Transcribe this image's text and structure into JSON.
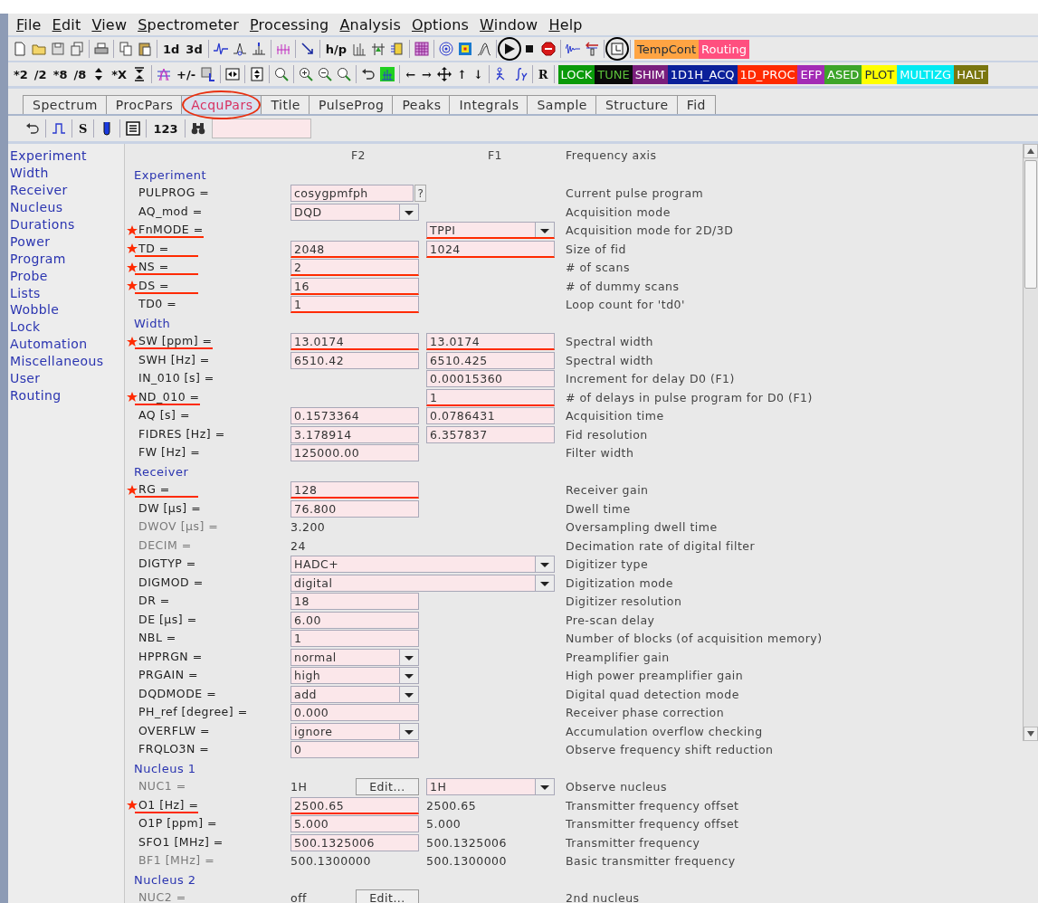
{
  "menu": [
    "File",
    "Edit",
    "View",
    "Spectrometer",
    "Processing",
    "Analysis",
    "Options",
    "Window",
    "Help"
  ],
  "toolbar_1": {
    "items": [
      {
        "kind": "icon",
        "circled": false
      },
      {
        "kind": "icon",
        "circled": false
      },
      {
        "kind": "icon",
        "circled": false
      },
      {
        "kind": "icon",
        "circled": false
      },
      {
        "kind": "separator"
      },
      {
        "kind": "icon",
        "circled": false
      },
      {
        "kind": "separator"
      },
      {
        "kind": "icon",
        "circled": false
      },
      {
        "kind": "icon",
        "circled": false
      },
      {
        "kind": "separator"
      },
      {
        "kind": "text",
        "label": "1d"
      },
      {
        "kind": "text",
        "label": "3d"
      },
      {
        "kind": "separator"
      },
      {
        "kind": "icon",
        "circled": false
      },
      {
        "kind": "icon",
        "circled": false
      },
      {
        "kind": "icon",
        "circled": false
      },
      {
        "kind": "separator"
      },
      {
        "kind": "icon",
        "circled": false
      },
      {
        "kind": "separator"
      },
      {
        "kind": "icon",
        "circled": false
      },
      {
        "kind": "separator"
      },
      {
        "kind": "text",
        "label": "h/p"
      },
      {
        "kind": "icon",
        "circled": false
      },
      {
        "kind": "icon",
        "circled": false
      },
      {
        "kind": "icon",
        "circled": false
      },
      {
        "kind": "separator"
      },
      {
        "kind": "icon",
        "circled": false
      },
      {
        "kind": "separator"
      },
      {
        "kind": "icon",
        "circled": false
      },
      {
        "kind": "icon",
        "circled": false
      },
      {
        "kind": "icon",
        "circled": false
      },
      {
        "kind": "separator"
      },
      {
        "kind": "icon",
        "circled": true
      },
      {
        "kind": "icon",
        "circled": false
      },
      {
        "kind": "icon",
        "circled": false
      },
      {
        "kind": "separator"
      },
      {
        "kind": "icon",
        "circled": false
      },
      {
        "kind": "icon",
        "circled": false
      },
      {
        "kind": "separator"
      },
      {
        "kind": "icon",
        "circled": true
      },
      {
        "kind": "separator"
      },
      {
        "kind": "color",
        "label": "TempCont",
        "color": "#ffa443"
      },
      {
        "kind": "color",
        "label": "Routing",
        "color": "#ff4f7f"
      }
    ]
  },
  "toolbar_2": {
    "items": [
      {
        "kind": "text",
        "label": "*2"
      },
      {
        "kind": "text",
        "label": "/2"
      },
      {
        "kind": "text",
        "label": "*8"
      },
      {
        "kind": "text",
        "label": "/8"
      },
      {
        "kind": "icon",
        "circled": false
      },
      {
        "kind": "text",
        "label": "*X"
      },
      {
        "kind": "icon",
        "circled": false
      },
      {
        "kind": "separator"
      },
      {
        "kind": "icon",
        "circled": false
      },
      {
        "kind": "text",
        "label": "+/-"
      },
      {
        "kind": "icon",
        "circled": false
      },
      {
        "kind": "separator"
      },
      {
        "kind": "icon",
        "circled": false
      },
      {
        "kind": "separator"
      },
      {
        "kind": "icon",
        "circled": false
      },
      {
        "kind": "separator"
      },
      {
        "kind": "icon",
        "circled": false
      },
      {
        "kind": "separator"
      },
      {
        "kind": "icon",
        "circled": false
      },
      {
        "kind": "icon",
        "circled": false
      },
      {
        "kind": "icon",
        "circled": false
      },
      {
        "kind": "separator"
      },
      {
        "kind": "icon",
        "circled": false
      },
      {
        "kind": "icon",
        "circled": false
      },
      {
        "kind": "separator"
      },
      {
        "kind": "text",
        "label": "←"
      },
      {
        "kind": "text",
        "label": "→"
      },
      {
        "kind": "icon",
        "circled": false
      },
      {
        "kind": "text",
        "label": "↑"
      },
      {
        "kind": "text",
        "label": "↓"
      },
      {
        "kind": "separator"
      },
      {
        "kind": "icon",
        "circled": false
      },
      {
        "kind": "icon",
        "circled": false
      },
      {
        "kind": "separator"
      },
      {
        "kind": "text",
        "label": "R"
      },
      {
        "kind": "separator"
      },
      {
        "kind": "color",
        "label": "LOCK",
        "color": "#0a9a0a"
      },
      {
        "kind": "color",
        "label": "TUNE",
        "color": "#0a0a0a"
      },
      {
        "kind": "color",
        "label": "SHIM",
        "color": "#7a1f7d"
      },
      {
        "kind": "color",
        "label": "1D1H_ACQ",
        "color": "#0b209a"
      },
      {
        "kind": "color",
        "label": "1D_PROC",
        "color": "#ff2a00"
      },
      {
        "kind": "color",
        "label": "EFP",
        "color": "#a32bb5"
      },
      {
        "kind": "color",
        "label": "ASED",
        "color": "#3da52a"
      },
      {
        "kind": "color",
        "label": "PLOT",
        "color": "#ffff00"
      },
      {
        "kind": "color",
        "label": "MULTIZG",
        "color": "#00eaf2"
      },
      {
        "kind": "color",
        "label": "HALT",
        "color": "#7a7610"
      }
    ]
  },
  "tabs": [
    {
      "label": "Spectrum",
      "selected": false,
      "circled": false
    },
    {
      "label": "ProcPars",
      "selected": false,
      "circled": false
    },
    {
      "label": "AcquPars",
      "selected": true,
      "circled": true
    },
    {
      "label": "Title",
      "selected": false,
      "circled": false
    },
    {
      "label": "PulseProg",
      "selected": false,
      "circled": false
    },
    {
      "label": "Peaks",
      "selected": false,
      "circled": false
    },
    {
      "label": "Integrals",
      "selected": false,
      "circled": false
    },
    {
      "label": "Sample",
      "selected": false,
      "circled": false
    },
    {
      "label": "Structure",
      "selected": false,
      "circled": false
    },
    {
      "label": "Fid",
      "selected": false,
      "circled": false
    }
  ],
  "sub_toolbar": {
    "items": [
      {
        "kind": "icon"
      },
      {
        "kind": "separator"
      },
      {
        "kind": "icon"
      },
      {
        "kind": "separator"
      },
      {
        "kind": "text",
        "label": "S"
      },
      {
        "kind": "separator"
      },
      {
        "kind": "icon"
      },
      {
        "kind": "separator"
      },
      {
        "kind": "icon"
      },
      {
        "kind": "separator"
      },
      {
        "kind": "text",
        "label": "123"
      },
      {
        "kind": "separator"
      },
      {
        "kind": "icon"
      },
      {
        "kind": "field"
      }
    ]
  },
  "sidebar": {
    "items": [
      "Experiment",
      "Width",
      "Receiver",
      "Nucleus",
      "Durations",
      "Power",
      "Program",
      "Probe",
      "Lists",
      "Wobble",
      "Lock",
      "Automation",
      "Miscellaneous",
      "User",
      "Routing"
    ]
  },
  "table": {
    "columns": [
      "F2",
      "F1",
      "Frequency axis"
    ],
    "rows": [
      {
        "kind": "section",
        "label": "Experiment"
      },
      {
        "kind": "param",
        "label": "PULPROG =",
        "starred": false,
        "dim": false,
        "f2": {
          "kind": "program",
          "value": "cosygpmfph",
          "button": "?",
          "marked": false
        },
        "desc": "Current pulse program"
      },
      {
        "kind": "param",
        "label": "AQ_mod =",
        "starred": false,
        "dim": false,
        "f2": {
          "kind": "select",
          "value": "DQD",
          "marked": false
        },
        "desc": "Acquisition mode"
      },
      {
        "kind": "param",
        "label": "FnMODE =",
        "starred": true,
        "dim": false,
        "f1": {
          "kind": "select",
          "value": "TPPI",
          "marked": true
        },
        "desc": "Acquisition mode for 2D/3D"
      },
      {
        "kind": "param",
        "label": "TD =",
        "starred": true,
        "dim": false,
        "f2": {
          "kind": "input",
          "value": "2048",
          "marked": true
        },
        "f1": {
          "kind": "input",
          "value": "1024",
          "marked": true
        },
        "desc": "Size of fid"
      },
      {
        "kind": "param",
        "label": "NS =",
        "starred": true,
        "dim": false,
        "f2": {
          "kind": "input",
          "value": "2",
          "marked": true
        },
        "desc": "# of scans"
      },
      {
        "kind": "param",
        "label": "DS =",
        "starred": true,
        "dim": false,
        "f2": {
          "kind": "input",
          "value": "16",
          "marked": true
        },
        "desc": "# of dummy scans"
      },
      {
        "kind": "param",
        "label": "TD0 =",
        "starred": false,
        "dim": false,
        "f2": {
          "kind": "input",
          "value": "1",
          "marked": true
        },
        "desc": "Loop count for 'td0'"
      },
      {
        "kind": "section",
        "label": "Width"
      },
      {
        "kind": "param",
        "label": "SW [ppm] =",
        "starred": true,
        "dim": false,
        "f2": {
          "kind": "input",
          "value": "13.0174",
          "marked": true
        },
        "f1": {
          "kind": "input",
          "value": "13.0174",
          "marked": true
        },
        "desc": "Spectral width"
      },
      {
        "kind": "param",
        "label": "SWH [Hz] =",
        "starred": false,
        "dim": false,
        "f2": {
          "kind": "input",
          "value": "6510.42",
          "marked": false
        },
        "f1": {
          "kind": "input",
          "value": "6510.425",
          "marked": false
        },
        "desc": "Spectral width"
      },
      {
        "kind": "param",
        "label": "IN_010 [s] =",
        "starred": false,
        "dim": false,
        "f1": {
          "kind": "input",
          "value": "0.00015360",
          "marked": false
        },
        "desc": "Increment for delay D0 (F1)"
      },
      {
        "kind": "param",
        "label": "ND_010 =",
        "starred": true,
        "dim": false,
        "f1": {
          "kind": "input",
          "value": "1",
          "marked": true
        },
        "desc": "# of delays in pulse program for D0 (F1)"
      },
      {
        "kind": "param",
        "label": "AQ [s] =",
        "starred": false,
        "dim": false,
        "f2": {
          "kind": "input",
          "value": "0.1573364",
          "marked": false
        },
        "f1": {
          "kind": "input",
          "value": "0.0786431",
          "marked": false
        },
        "desc": "Acquisition time"
      },
      {
        "kind": "param",
        "label": "FIDRES [Hz] =",
        "starred": false,
        "dim": false,
        "f2": {
          "kind": "input",
          "value": "3.178914",
          "marked": false
        },
        "f1": {
          "kind": "input",
          "value": "6.357837",
          "marked": false
        },
        "desc": "Fid resolution"
      },
      {
        "kind": "param",
        "label": "FW [Hz] =",
        "starred": false,
        "dim": false,
        "f2": {
          "kind": "input",
          "value": "125000.00",
          "marked": false
        },
        "desc": "Filter width"
      },
      {
        "kind": "section",
        "label": "Receiver"
      },
      {
        "kind": "param",
        "label": "RG =",
        "starred": true,
        "dim": false,
        "f2": {
          "kind": "input",
          "value": "128",
          "marked": true
        },
        "desc": "Receiver gain"
      },
      {
        "kind": "param",
        "label": "DW [µs] =",
        "starred": false,
        "dim": false,
        "f2": {
          "kind": "input",
          "value": "76.800",
          "marked": false
        },
        "desc": "Dwell time"
      },
      {
        "kind": "param",
        "label": "DWOV [µs] =",
        "starred": false,
        "dim": true,
        "f2": {
          "kind": "plain",
          "value": "3.200",
          "marked": false
        },
        "desc": "Oversampling dwell time"
      },
      {
        "kind": "param",
        "label": "DECIM =",
        "starred": false,
        "dim": true,
        "f2": {
          "kind": "plain",
          "value": "24",
          "marked": false
        },
        "desc": "Decimation rate of digital filter"
      },
      {
        "kind": "param",
        "label": "DIGTYP =",
        "starred": false,
        "dim": false,
        "f2": {
          "kind": "select",
          "value": "HADC+",
          "wide": true,
          "marked": false
        },
        "desc": "Digitizer type"
      },
      {
        "kind": "param",
        "label": "DIGMOD =",
        "starred": false,
        "dim": false,
        "f2": {
          "kind": "select",
          "value": "digital",
          "wide": true,
          "marked": false
        },
        "desc": "Digitization mode"
      },
      {
        "kind": "param",
        "label": "DR =",
        "starred": false,
        "dim": false,
        "f2": {
          "kind": "input",
          "value": "18",
          "marked": false
        },
        "desc": "Digitizer resolution"
      },
      {
        "kind": "param",
        "label": "DE [µs] =",
        "starred": false,
        "dim": false,
        "f2": {
          "kind": "input",
          "value": "6.00",
          "marked": false
        },
        "desc": "Pre-scan delay"
      },
      {
        "kind": "param",
        "label": "NBL =",
        "starred": false,
        "dim": false,
        "f2": {
          "kind": "input",
          "value": "1",
          "marked": false
        },
        "desc": "Number of blocks (of acquisition memory)"
      },
      {
        "kind": "param",
        "label": "HPPRGN =",
        "starred": false,
        "dim": false,
        "f2": {
          "kind": "select",
          "value": "normal",
          "marked": false
        },
        "desc": "Preamplifier gain"
      },
      {
        "kind": "param",
        "label": "PRGAIN =",
        "starred": false,
        "dim": false,
        "f2": {
          "kind": "select",
          "value": "high",
          "marked": false
        },
        "desc": "High power preamplifier gain"
      },
      {
        "kind": "param",
        "label": "DQDMODE =",
        "starred": false,
        "dim": false,
        "f2": {
          "kind": "select",
          "value": "add",
          "marked": false
        },
        "desc": "Digital quad detection mode"
      },
      {
        "kind": "param",
        "label": "PH_ref [degree] =",
        "starred": false,
        "dim": false,
        "f2": {
          "kind": "input",
          "value": "0.000",
          "marked": false
        },
        "desc": "Receiver phase correction"
      },
      {
        "kind": "param",
        "label": "OVERFLW =",
        "starred": false,
        "dim": false,
        "f2": {
          "kind": "select",
          "value": "ignore",
          "marked": false
        },
        "desc": "Accumulation overflow checking"
      },
      {
        "kind": "param",
        "label": "FRQLO3N =",
        "starred": false,
        "dim": false,
        "f2": {
          "kind": "input",
          "value": "0",
          "marked": false
        },
        "desc": "Observe frequency shift reduction"
      },
      {
        "kind": "section",
        "label": "Nucleus 1"
      },
      {
        "kind": "param",
        "label": "NUC1 =",
        "starred": false,
        "dim": true,
        "f2": {
          "kind": "edit",
          "value": "1H",
          "button": "Edit...",
          "marked": false
        },
        "f1": {
          "kind": "select",
          "value": "1H",
          "marked": false
        },
        "desc": "Observe nucleus"
      },
      {
        "kind": "param",
        "label": "O1 [Hz] =",
        "starred": true,
        "dim": false,
        "f2": {
          "kind": "input",
          "value": "2500.65",
          "marked": true
        },
        "f1": {
          "kind": "plain",
          "value": "2500.65",
          "marked": false
        },
        "desc": "Transmitter frequency offset"
      },
      {
        "kind": "param",
        "label": "O1P [ppm] =",
        "starred": false,
        "dim": false,
        "f2": {
          "kind": "input",
          "value": "5.000",
          "marked": false
        },
        "f1": {
          "kind": "plain",
          "value": "5.000",
          "marked": false
        },
        "desc": "Transmitter frequency offset"
      },
      {
        "kind": "param",
        "label": "SFO1 [MHz] =",
        "starred": false,
        "dim": false,
        "f2": {
          "kind": "input",
          "value": "500.1325006",
          "marked": false
        },
        "f1": {
          "kind": "plain",
          "value": "500.1325006",
          "marked": false
        },
        "desc": "Transmitter frequency"
      },
      {
        "kind": "param",
        "label": "BF1 [MHz] =",
        "starred": false,
        "dim": true,
        "f2": {
          "kind": "plain",
          "value": "500.1300000",
          "marked": false
        },
        "f1": {
          "kind": "plain",
          "value": "500.1300000",
          "marked": false
        },
        "desc": "Basic transmitter frequency"
      },
      {
        "kind": "section",
        "label": "Nucleus 2"
      },
      {
        "kind": "param",
        "label": "NUC2 =",
        "starred": false,
        "dim": true,
        "f2": {
          "kind": "edit",
          "value": "off",
          "button": "Edit...",
          "marked": false
        },
        "desc": "2nd nucleus"
      }
    ]
  }
}
